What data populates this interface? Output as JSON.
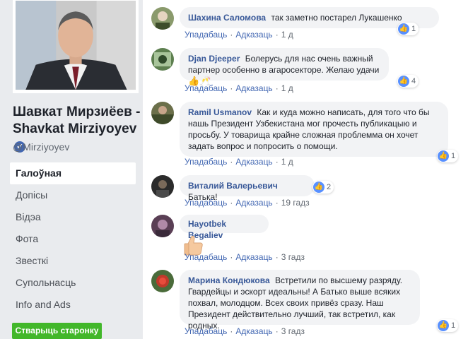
{
  "sidebar": {
    "page_name": "Шавкат Мирзиёев - Shavkat Mirziyoyev",
    "handle": "@Mirziyoyev",
    "nav": [
      {
        "label": "Галоўная",
        "active": true
      },
      {
        "label": "Допісы"
      },
      {
        "label": "Відэа"
      },
      {
        "label": "Фота"
      },
      {
        "label": "Звесткі"
      },
      {
        "label": "Супольнасць"
      },
      {
        "label": "Info and Ads"
      }
    ],
    "create_page_label": "Стварыць старонку"
  },
  "labels": {
    "like": "Упадабаць",
    "reply": "Адказаць",
    "separator": "·"
  },
  "comments": [
    {
      "author": "Шахина Саломова",
      "text": "так заметно постарел Лукашенко",
      "time": "1 д",
      "reactions": "1"
    },
    {
      "author": "Djan Djeeper",
      "text": "Болерусь для нас очень важный партнер особенно в агаросекторе. Желаю удачи",
      "emoji": "👍🥂",
      "time": "1 д",
      "reactions": "4"
    },
    {
      "author": "Ramil Usmanov",
      "text": "Как и куда можно написать, для того что бы нашь Президент Узбекистана мог прочесть публикацыю и просьбу. У товарища крайне сложная проблемма он хочет задать вопрос и попросить о помощи.",
      "time": "1 д",
      "reactions": "1"
    },
    {
      "author": "Виталий Валерьевич",
      "text": "Батька!",
      "time": "19 гадз",
      "reactions": "2"
    },
    {
      "author": "Hayotbek Begaliev",
      "text": "",
      "time": "3 гадз"
    },
    {
      "author": "Марина Кондюкова",
      "text": "Встретили по высшему разряду. Гвардейцы и эскорт идеальны! А Батько выше всяких похвал, молодцом. Всех своих привёз сразу. Наш Президент действительно лучший, так встретил, как родных.",
      "time": "3 гадз",
      "reactions": "1"
    }
  ]
}
